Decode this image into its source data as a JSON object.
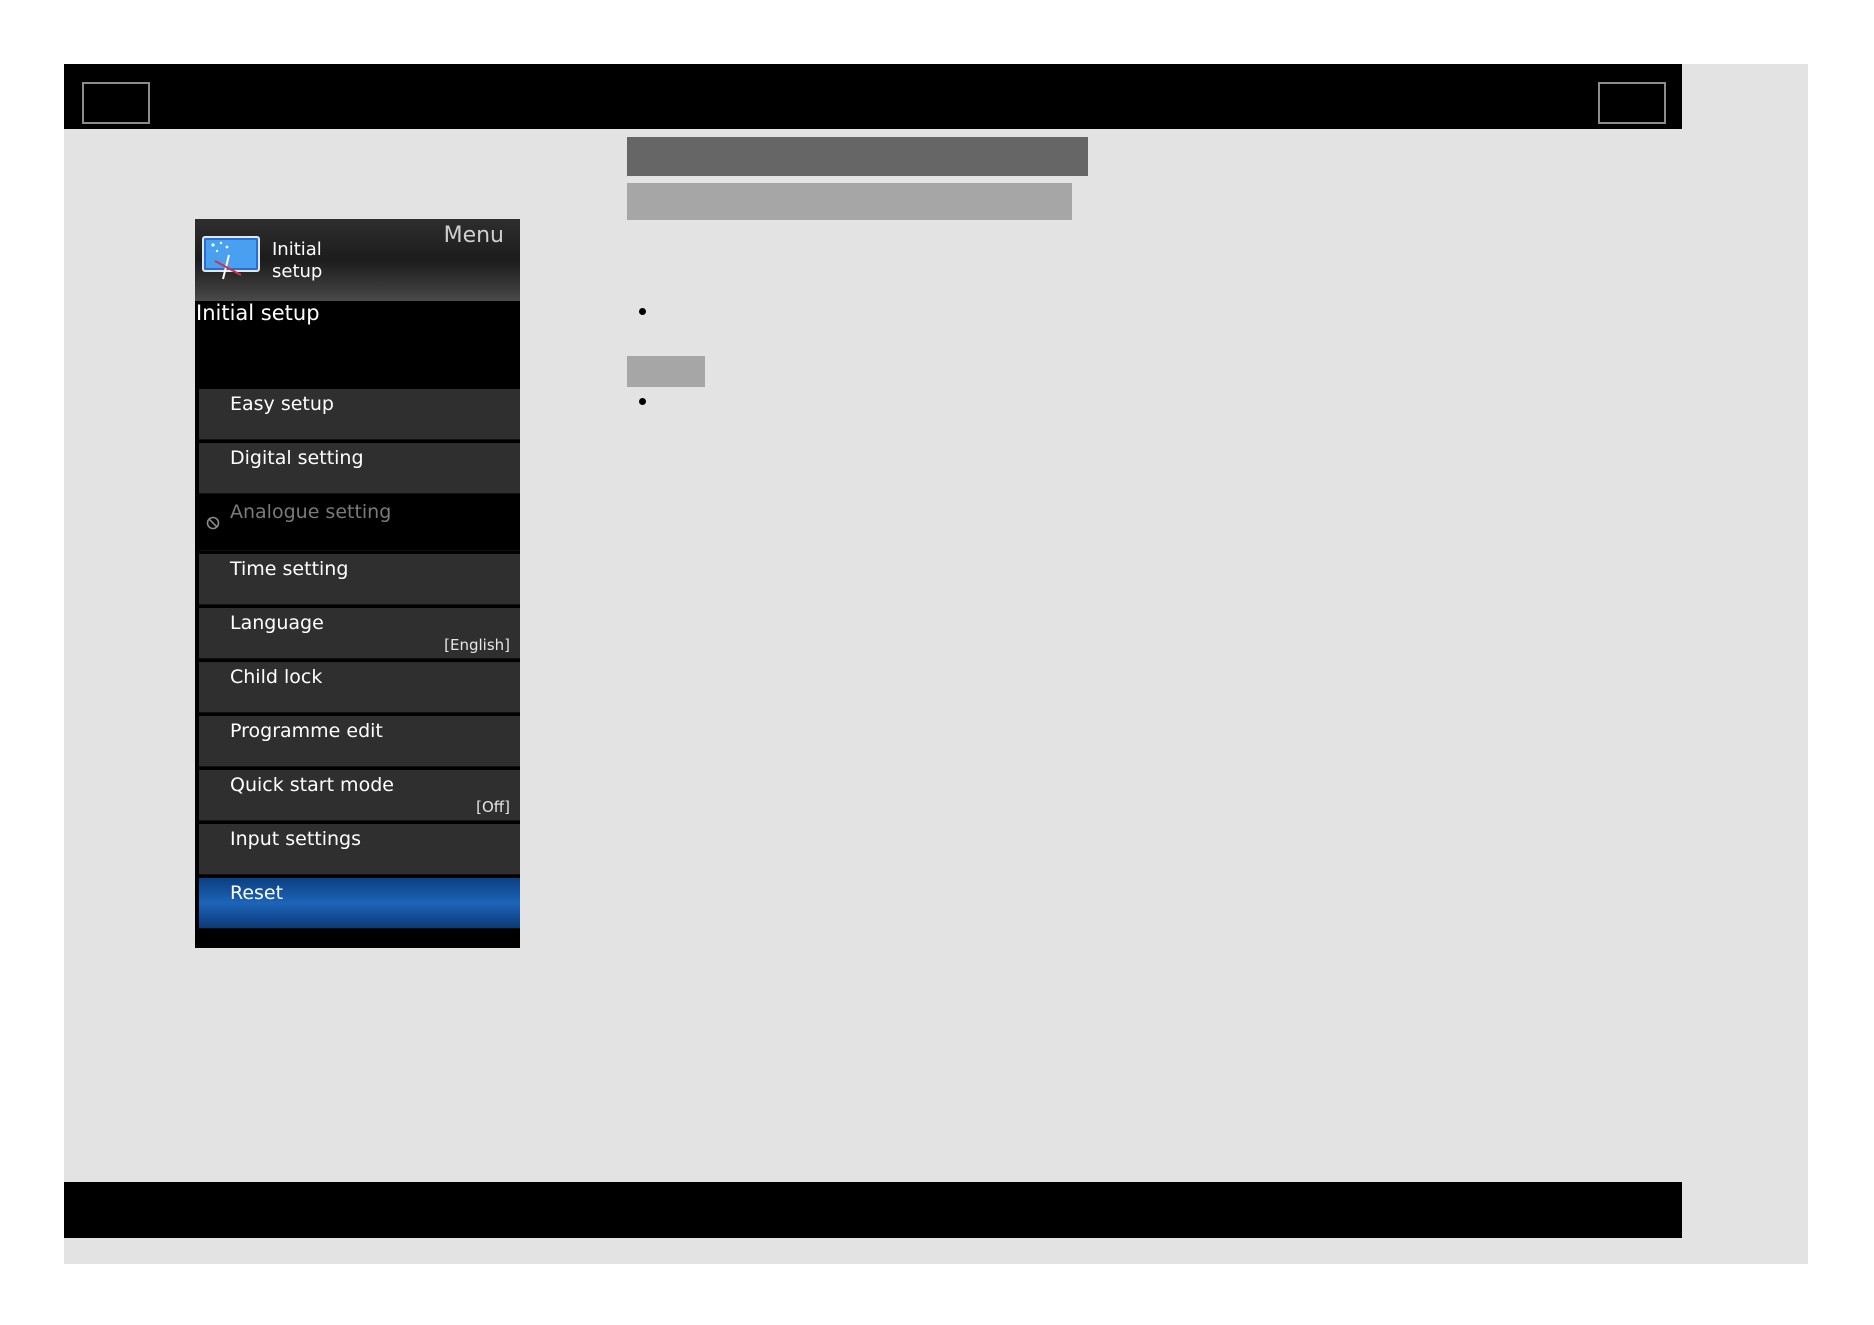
{
  "menu": {
    "title": "Menu",
    "header_label": "Initial setup",
    "section_title": "Initial setup",
    "items": [
      {
        "label": "Easy setup",
        "value": ""
      },
      {
        "label": "Digital setting",
        "value": ""
      },
      {
        "label": "Analogue setting",
        "value": "",
        "state": "disabled"
      },
      {
        "label": "Time setting",
        "value": ""
      },
      {
        "label": "Language",
        "value": "[English]"
      },
      {
        "label": "Child lock",
        "value": ""
      },
      {
        "label": "Programme edit",
        "value": ""
      },
      {
        "label": "Quick start mode",
        "value": "[Off]"
      },
      {
        "label": "Input settings",
        "value": ""
      },
      {
        "label": "Reset",
        "value": "",
        "state": "selected"
      }
    ]
  },
  "colors": {
    "selected_item": "#1d64b8",
    "menu_background": "#000000",
    "page_background": "#e3e3e3"
  },
  "icons": {
    "header": "tv-setup-icon",
    "disabled": "prohibited-icon"
  }
}
